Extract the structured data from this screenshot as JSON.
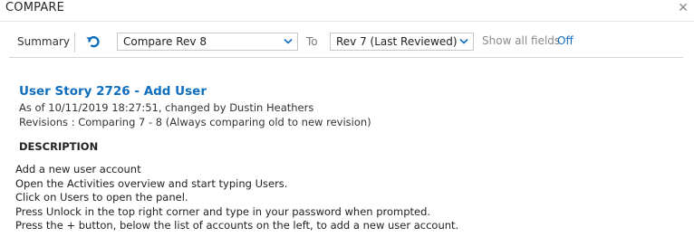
{
  "dialog": {
    "title": "COMPARE",
    "close_glyph": "✕"
  },
  "toolbar": {
    "summary_label": "Summary",
    "undo_icon": "undo-icon",
    "compare_from": "Compare Rev 8",
    "to_label": "To",
    "compare_to": "Rev 7 (Last Reviewed)",
    "show_all_label": "Show all fields",
    "show_all_value": "Off"
  },
  "work_item": {
    "title": "User Story 2726 - Add User",
    "as_of": "As of 10/11/2019 18:27:51, changed by Dustin Heathers",
    "revisions": "Revisions : Comparing 7 - 8 (Always comparing old to new revision)"
  },
  "description": {
    "heading": "DESCRIPTION",
    "lines": [
      "Add a new user account",
      "Open the Activities overview and start typing Users.",
      "Click on Users to open the panel.",
      "Press Unlock in the top right corner and type in your password when prompted.",
      "Press the + button, below the list of accounts on the left, to add a new user account."
    ]
  },
  "colors": {
    "accent": "#106ebe",
    "text": "#222222",
    "muted": "#8a8a8a"
  }
}
